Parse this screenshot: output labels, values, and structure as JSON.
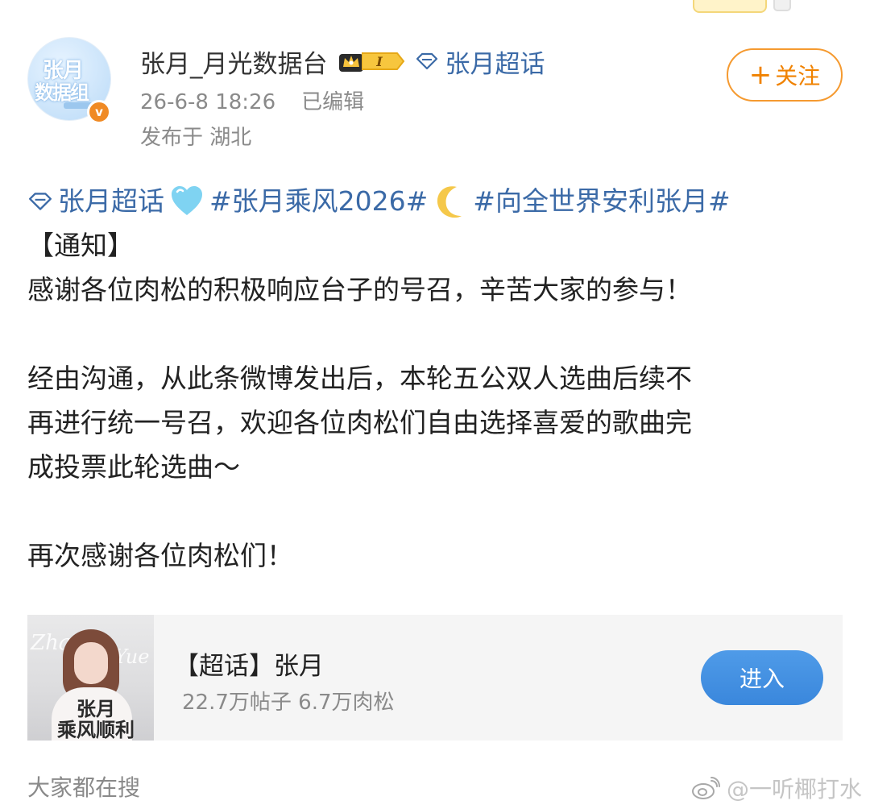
{
  "colors": {
    "link": "#3b6aa7",
    "follow_accent": "#f08200",
    "enter_button": "#3a87dc",
    "meta_gray": "#8a8a8a"
  },
  "author": {
    "username": "张月_月光数据台",
    "level_badge": "I",
    "topic_link": "张月超话",
    "verified_icon": "v-badge-icon",
    "avatar_text_1": "张月",
    "avatar_text_2": "数据组"
  },
  "meta": {
    "time": "26-6-8 18:26",
    "edited": "已编辑",
    "location": "发布于 湖北"
  },
  "follow_button": {
    "plus": "+",
    "label": "关注"
  },
  "post": {
    "tag_topic": "张月超话",
    "tag_1": "#张月乘风2026#",
    "tag_2": "#向全世界安利张月#",
    "notice": "【通知】",
    "line1": "感谢各位肉松的积极响应台子的号召，辛苦大家的参与！",
    "para2_l1": "经由沟通，从此条微博发出后，本轮五公双人选曲后续不",
    "para2_l2": "再进行统一号召，欢迎各位肉松们自由选择喜爱的歌曲完",
    "para2_l3": "成投票此轮选曲～",
    "line_last": "再次感谢各位肉松们！"
  },
  "card": {
    "title": "【超话】张月",
    "stats": "22.7万帖子 6.7万肉松",
    "enter_label": "进入",
    "image_caption_1": "张月",
    "image_caption_2": "乘风顺利",
    "image_script_1": "Zha",
    "image_script_2": "Yue"
  },
  "footer": {
    "search_label": "大家都在搜",
    "watermark": "@一听椰打水"
  }
}
